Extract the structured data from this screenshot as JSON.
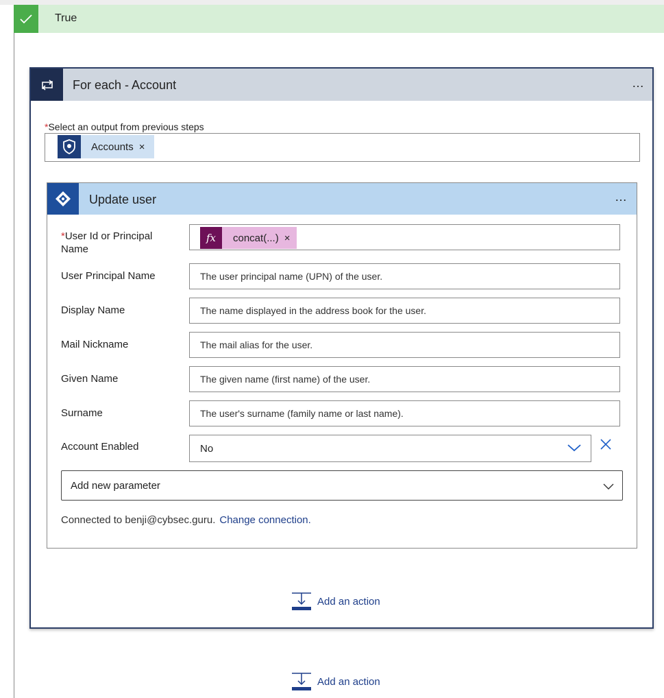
{
  "branch": {
    "label": "True",
    "status_color": "#4aad4a"
  },
  "foreach": {
    "title": "For each - Account",
    "more": "…",
    "select_label": "Select an output from previous steps",
    "required_mark": "*",
    "token": {
      "label": "Accounts",
      "remove": "×",
      "icon": "shield-icon"
    }
  },
  "update_user": {
    "title": "Update user",
    "more": "…",
    "fields": [
      {
        "label": "User Id or Principal Name",
        "required": "*",
        "token": {
          "label": "concat(...)",
          "remove": "×",
          "fx": "fx"
        }
      },
      {
        "label": "User Principal Name",
        "placeholder": "The user principal name (UPN) of the user."
      },
      {
        "label": "Display Name",
        "placeholder": "The name displayed in the address book for the user."
      },
      {
        "label": "Mail Nickname",
        "placeholder": "The mail alias for the user."
      },
      {
        "label": "Given Name",
        "placeholder": "The given name (first name) of the user."
      },
      {
        "label": "Surname",
        "placeholder": "The user's surname (family name or last name)."
      },
      {
        "label": "Account Enabled",
        "value": "No"
      }
    ],
    "add_parameter": "Add new parameter",
    "connected_text": "Connected to benji@cybsec.guru.",
    "change_connection": "Change connection."
  },
  "actions": {
    "add_inner": "Add an action",
    "add_outer": "Add an action"
  },
  "colors": {
    "accent": "#1e3e8a",
    "foreach_header": "#cfd6df",
    "update_header": "#b9d6f0"
  }
}
